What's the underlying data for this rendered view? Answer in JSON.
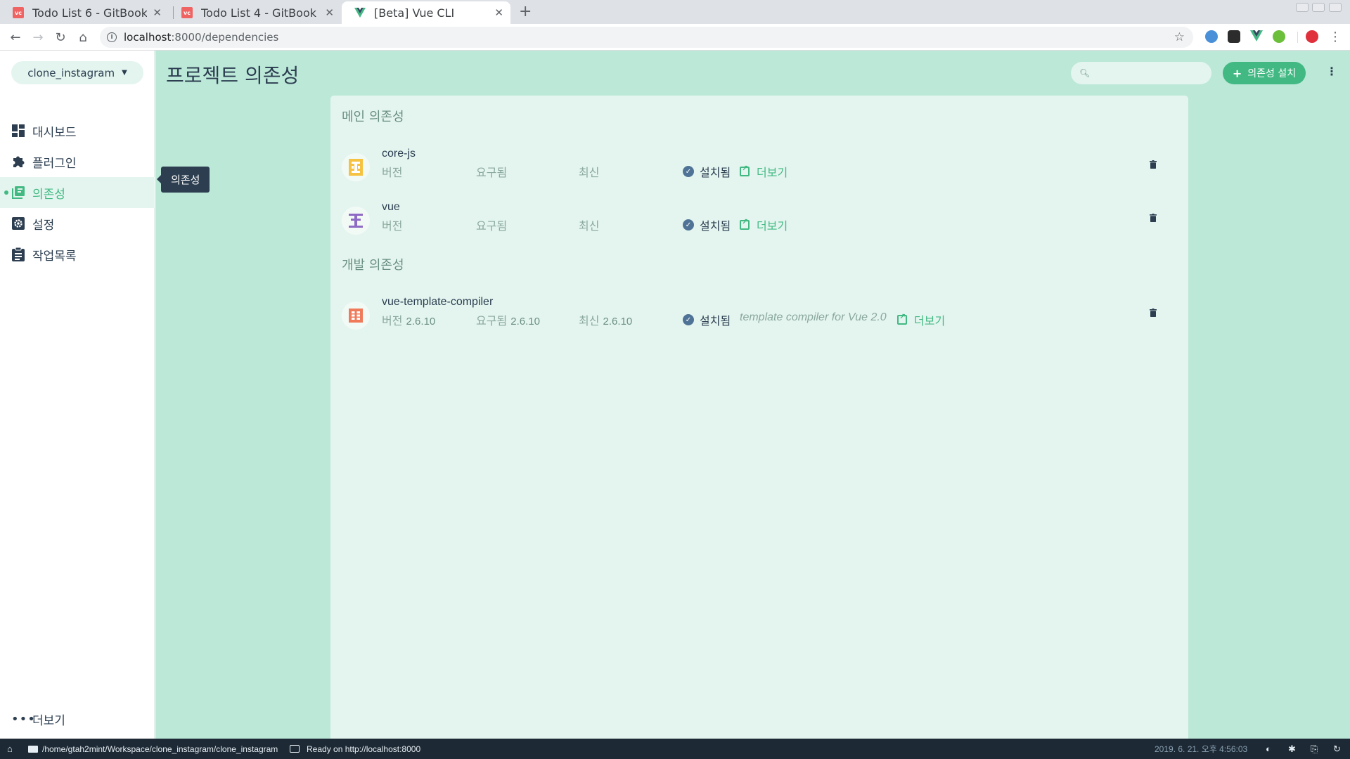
{
  "browser": {
    "tabs": [
      {
        "title": "Todo List 6 - GitBook",
        "favicon": "gitbook-icon"
      },
      {
        "title": "Todo List 4 - GitBook",
        "favicon": "gitbook-icon"
      },
      {
        "title": "[Beta] Vue CLI",
        "favicon": "vue-icon",
        "active": true
      }
    ],
    "url_host": "localhost",
    "url_path": ":8000/dependencies"
  },
  "sidebar": {
    "project": "clone_instagram",
    "items": [
      {
        "label": "대시보드",
        "icon": "dashboard-icon"
      },
      {
        "label": "플러그인",
        "icon": "puzzle-icon"
      },
      {
        "label": "의존성",
        "icon": "collections-icon",
        "active": true
      },
      {
        "label": "설정",
        "icon": "settings-icon"
      },
      {
        "label": "작업목록",
        "icon": "clipboard-icon"
      }
    ],
    "tooltip": "의존성",
    "more": "더보기"
  },
  "header": {
    "title": "프로젝트 의존성",
    "search_placeholder": "",
    "install_label": "의존성 설치"
  },
  "sections": {
    "main_title": "메인 의존성",
    "dev_title": "개발 의존성"
  },
  "labels": {
    "version": "버전",
    "wanted": "요구됨",
    "latest": "최신",
    "installed": "설치됨",
    "more": "더보기"
  },
  "dependencies": {
    "core_js": {
      "name": "core-js",
      "version": "",
      "wanted": "",
      "latest": ""
    },
    "vue": {
      "name": "vue",
      "version": "",
      "wanted": "",
      "latest": ""
    },
    "vtc": {
      "name": "vue-template-compiler",
      "version": "2.6.10",
      "wanted": "2.6.10",
      "latest": "2.6.10",
      "description": "template compiler for Vue 2.0"
    }
  },
  "statusbar": {
    "path": "/home/gtah2mint/Workspace/clone_instagram/clone_instagram",
    "ready": "Ready on http://localhost:8000",
    "datetime": "2019. 6. 21. 오후 4:56:03"
  },
  "colors": {
    "accent": "#42b983",
    "content_bg": "#bce8d8",
    "panel_bg": "#e4f5ef",
    "dark": "#2c3e50"
  }
}
